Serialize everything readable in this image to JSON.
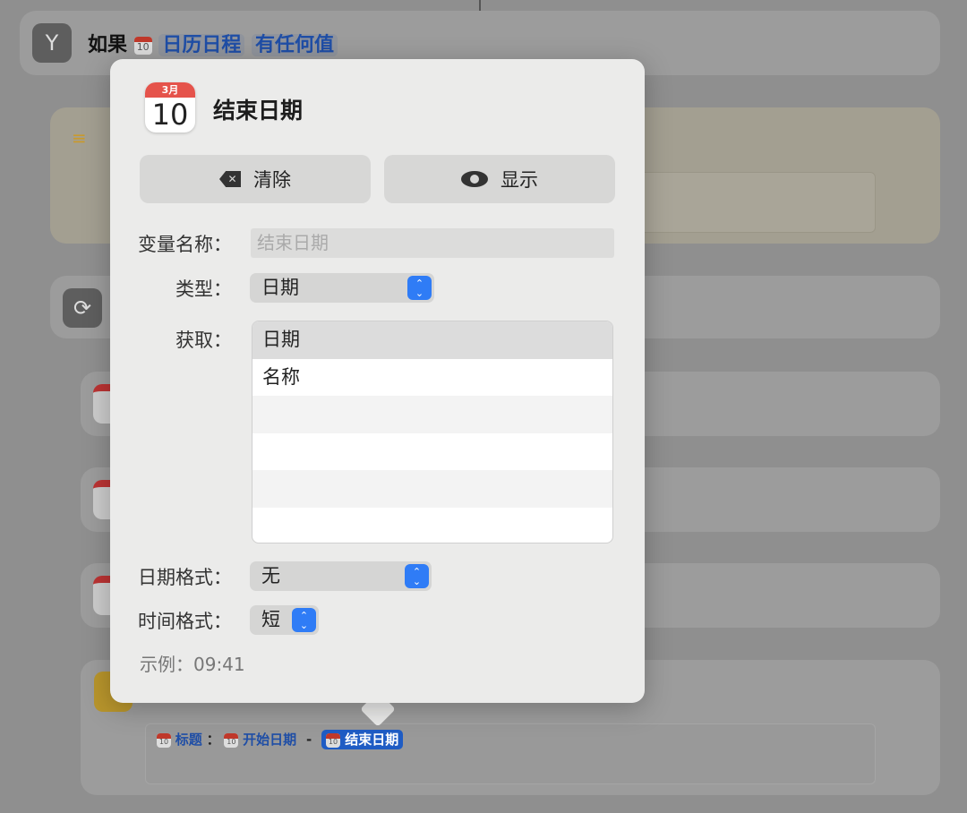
{
  "background": {
    "if_action": {
      "label": "如果",
      "variable": "日历日程",
      "condition": "有任何值"
    },
    "text_action": {
      "tokens": [
        {
          "label": "标题"
        },
        {
          "sep": "："
        },
        {
          "label": "开始日期"
        },
        {
          "sep": "-"
        },
        {
          "label": "结束日期",
          "selected": true
        }
      ]
    }
  },
  "popover": {
    "icon": {
      "month": "3月",
      "day": "10"
    },
    "title": "结束日期",
    "clear_button": "清除",
    "show_button": "显示",
    "variable_name": {
      "label": "变量名称：",
      "placeholder": "结束日期"
    },
    "type": {
      "label": "类型：",
      "value": "日期"
    },
    "get": {
      "label": "获取：",
      "options": [
        "日期",
        "名称",
        "",
        "",
        "",
        ""
      ],
      "selected": "日期"
    },
    "date_format": {
      "label": "日期格式：",
      "value": "无"
    },
    "time_format": {
      "label": "时间格式：",
      "value": "短"
    },
    "example": "示例：09:41"
  },
  "colors": {
    "accent": "#2f7cf6",
    "token": "#1f4ea6",
    "calendar_red": "#e5534b"
  }
}
